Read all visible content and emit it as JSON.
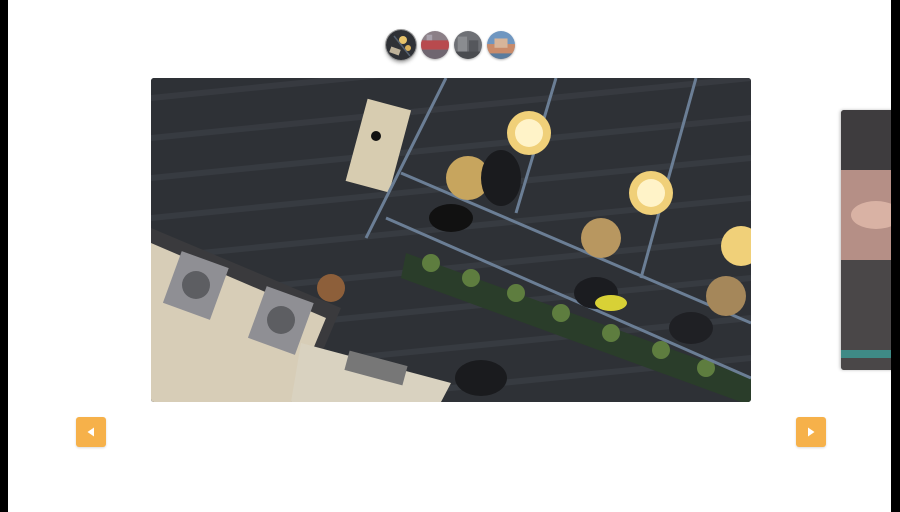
{
  "carousel": {
    "thumbnails": [
      {
        "icon": "cafe-thumbnail-icon",
        "active": true
      },
      {
        "icon": "red-scene-thumbnail-icon",
        "active": false
      },
      {
        "icon": "gray-scene-thumbnail-icon",
        "active": false
      },
      {
        "icon": "blue-scene-thumbnail-icon",
        "active": false
      }
    ],
    "main_slide": {
      "icon": "overhead-cafe-photo-icon"
    },
    "next_slide": {
      "icon": "next-photo-peek-icon"
    },
    "prev_button": {
      "icon": "play-left-icon"
    },
    "next_button": {
      "icon": "play-right-icon"
    }
  },
  "colors": {
    "arrow_bg": "#f6b14a",
    "page_bg": "#ffffff",
    "frame": "#000000"
  }
}
